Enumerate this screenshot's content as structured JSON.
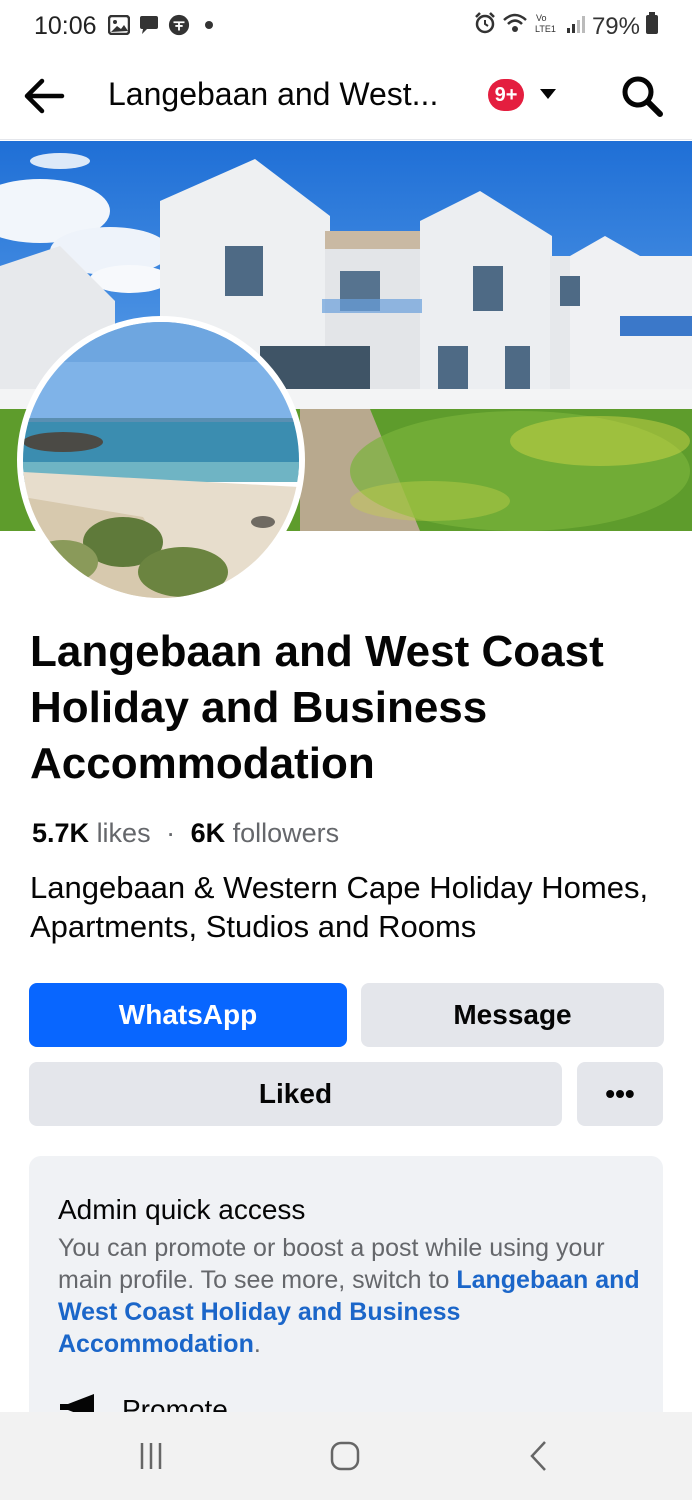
{
  "status_bar": {
    "time": "10:06",
    "battery": "79%",
    "left_icons": [
      "gallery-icon",
      "chat-icon",
      "vpn-icon",
      "dot-icon"
    ],
    "right_icons": [
      "alarm-icon",
      "wifi-icon",
      "volte-icon",
      "signal-icon",
      "battery-icon"
    ]
  },
  "header": {
    "title": "Langebaan and West...",
    "notification_badge": "9+"
  },
  "page": {
    "name": "Langebaan and West Coast Holiday and Business Accommodation",
    "likes_count": "5.7K",
    "likes_label": "likes",
    "followers_count": "6K",
    "followers_label": "followers",
    "separator": "·",
    "description": "Langebaan & Western Cape Holiday Homes, Apartments, Studios and Rooms"
  },
  "actions": {
    "whatsapp": "WhatsApp",
    "message": "Message",
    "liked": "Liked",
    "more": "•••"
  },
  "admin": {
    "title": "Admin quick access",
    "text_before_link": "You can promote or boost a post while using your main profile. To see more, switch to ",
    "link_text": "Langebaan and West Coast Holiday and Business Accommodation",
    "text_after_link": ".",
    "promote_label": "Promote"
  },
  "colors": {
    "primary_blue": "#0866ff",
    "badge_red": "#e41e3f",
    "secondary_button": "#e4e6eb",
    "link_blue": "#1b66c9"
  }
}
